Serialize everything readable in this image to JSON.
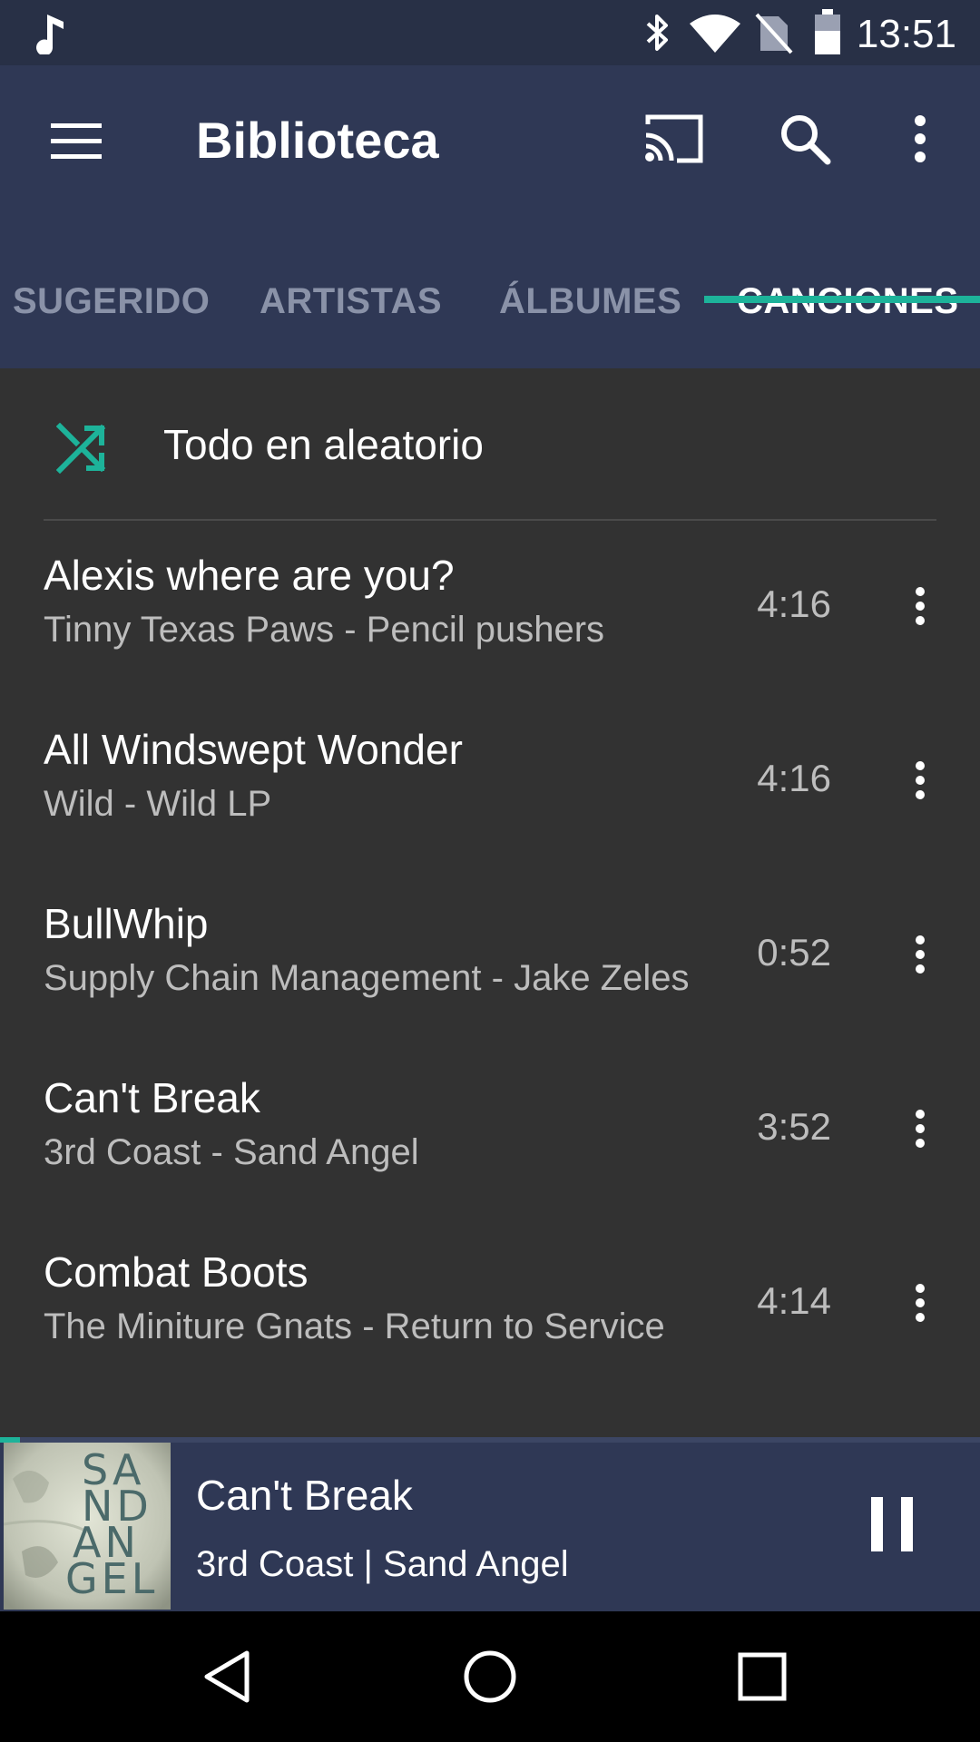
{
  "status_bar": {
    "time": "13:51",
    "icons": [
      "music-note-icon",
      "bluetooth-icon",
      "wifi-icon",
      "no-sim-icon",
      "battery-icon"
    ]
  },
  "app_bar": {
    "title": "Biblioteca",
    "icons": [
      "menu-icon",
      "cast-icon",
      "search-icon",
      "more-vert-icon"
    ]
  },
  "tabs": [
    {
      "label": "SUGERIDO",
      "active": false
    },
    {
      "label": "ARTISTAS",
      "active": false
    },
    {
      "label": "ÁLBUMES",
      "active": false
    },
    {
      "label": "CANCIONES",
      "active": true
    }
  ],
  "shuffle": {
    "label": "Todo en aleatorio",
    "icon": "shuffle-icon"
  },
  "songs": [
    {
      "title": "Alexis where are you?",
      "subtitle": "Tinny Texas Paws - Pencil pushers",
      "duration": "4:16"
    },
    {
      "title": "All Windswept Wonder",
      "subtitle": "Wild - Wild LP",
      "duration": "4:16"
    },
    {
      "title": "BullWhip",
      "subtitle": "Supply Chain Management - Jake Zeles",
      "duration": "0:52"
    },
    {
      "title": "Can't Break",
      "subtitle": "3rd Coast - Sand Angel",
      "duration": "3:52"
    },
    {
      "title": "Combat Boots",
      "subtitle": "The Miniture Gnats - Return to Service",
      "duration": "4:14"
    }
  ],
  "now_playing": {
    "title": "Can't Break",
    "subtitle": "3rd Coast | Sand Angel",
    "progress_fraction": 0.02,
    "album_art_text": [
      "SA",
      "ND",
      "AN",
      "GEL"
    ],
    "icon": "pause-icon"
  },
  "nav_bar": {
    "icons": [
      "back-icon",
      "home-icon",
      "recents-icon"
    ]
  },
  "colors": {
    "accent": "#1db39a",
    "app_bar": "#2f3855",
    "status_bar": "#283046",
    "background": "#323232",
    "inactive_tab": "#8a92a8"
  }
}
